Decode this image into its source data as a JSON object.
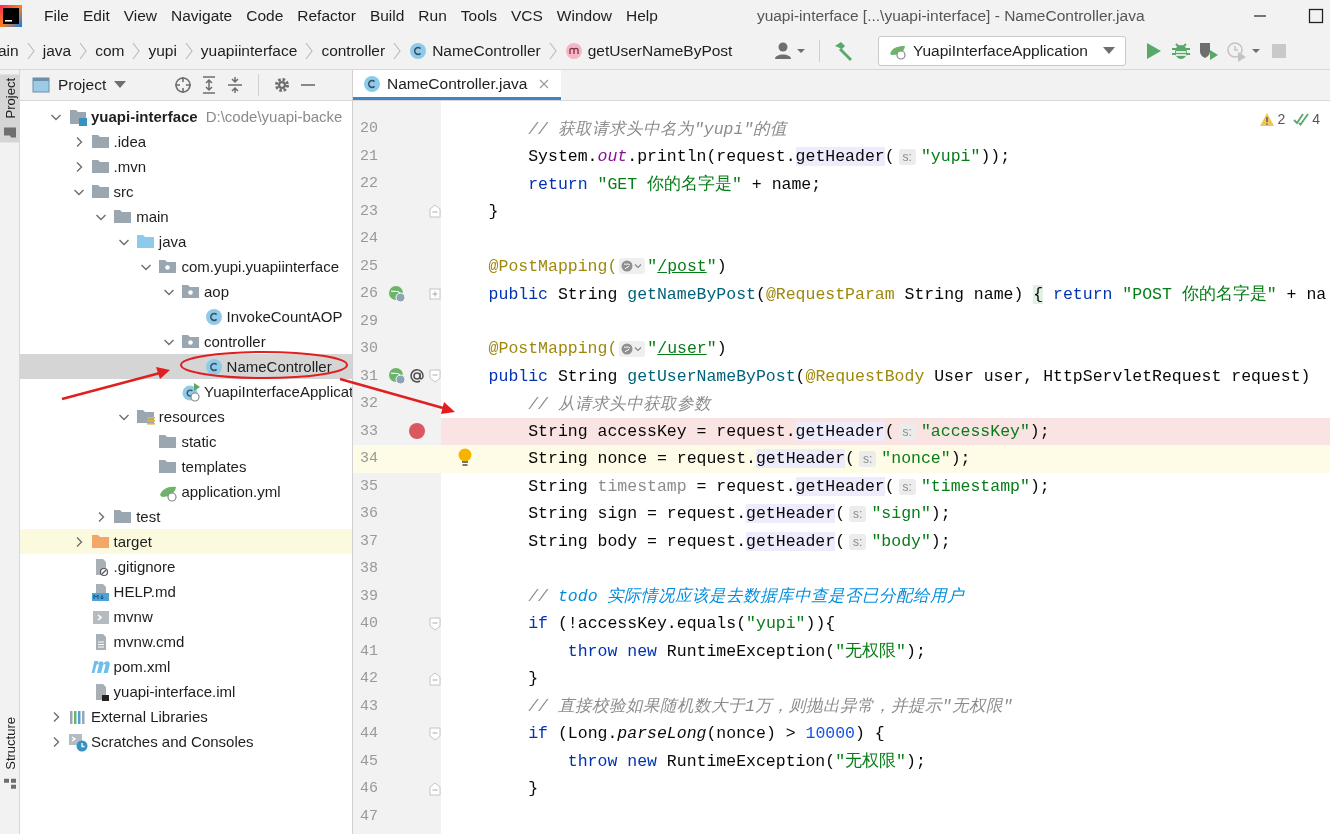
{
  "window": {
    "title": "yuapi-interface [...\\yuapi-interface] - NameController.java"
  },
  "menu": [
    "File",
    "Edit",
    "View",
    "Navigate",
    "Code",
    "Refactor",
    "Build",
    "Run",
    "Tools",
    "VCS",
    "Window",
    "Help"
  ],
  "breadcrumbs": [
    {
      "label": "ain",
      "kind": "plain"
    },
    {
      "label": "java",
      "kind": "plain"
    },
    {
      "label": "com",
      "kind": "plain"
    },
    {
      "label": "yupi",
      "kind": "plain"
    },
    {
      "label": "yuapiinterface",
      "kind": "plain"
    },
    {
      "label": "controller",
      "kind": "plain"
    },
    {
      "label": "NameController",
      "kind": "class"
    },
    {
      "label": "getUserNameByPost",
      "kind": "method"
    }
  ],
  "run_config": {
    "label": "YuapiInterfaceApplication"
  },
  "side_strip": [
    {
      "label": "Project",
      "selected": true
    },
    {
      "label": "Structure",
      "selected": false
    }
  ],
  "project_panel": {
    "title": "Project",
    "tree": [
      {
        "label": "yuapi-interface",
        "path": "D:\\code\\yuapi-backe",
        "kind": "module",
        "expanded": true,
        "selected": false,
        "children": [
          {
            "label": ".idea",
            "kind": "folder",
            "expanded": false,
            "selected": false
          },
          {
            "label": ".mvn",
            "kind": "folder",
            "expanded": false,
            "selected": false
          },
          {
            "label": "src",
            "kind": "folder",
            "expanded": true,
            "selected": false,
            "children": [
              {
                "label": "main",
                "kind": "folder",
                "expanded": true,
                "selected": false,
                "children": [
                  {
                    "label": "java",
                    "kind": "source",
                    "expanded": true,
                    "selected": false,
                    "children": [
                      {
                        "label": "com.yupi.yuapiinterface",
                        "kind": "package",
                        "expanded": true,
                        "selected": false,
                        "children": [
                          {
                            "label": "aop",
                            "kind": "package",
                            "expanded": true,
                            "selected": false,
                            "children": [
                              {
                                "label": "InvokeCountAOP",
                                "kind": "class",
                                "selected": false
                              }
                            ]
                          },
                          {
                            "label": "controller",
                            "kind": "package",
                            "expanded": true,
                            "selected": false,
                            "children": [
                              {
                                "label": "NameController",
                                "kind": "class",
                                "selected": true
                              }
                            ]
                          },
                          {
                            "label": "YuapiInterfaceApplicat",
                            "kind": "spring-class",
                            "selected": false
                          }
                        ]
                      }
                    ]
                  },
                  {
                    "label": "resources",
                    "kind": "resources",
                    "expanded": true,
                    "selected": false,
                    "children": [
                      {
                        "label": "static",
                        "kind": "folder",
                        "selected": false
                      },
                      {
                        "label": "templates",
                        "kind": "folder",
                        "selected": false
                      },
                      {
                        "label": "application.yml",
                        "kind": "yaml",
                        "selected": false
                      }
                    ]
                  }
                ]
              },
              {
                "label": "test",
                "kind": "folder",
                "expanded": false,
                "selected": false
              }
            ]
          },
          {
            "label": "target",
            "kind": "excluded",
            "expanded": false,
            "selected": false
          },
          {
            "label": ".gitignore",
            "kind": "ignore",
            "selected": false
          },
          {
            "label": "HELP.md",
            "kind": "markdown",
            "selected": false
          },
          {
            "label": "mvnw",
            "kind": "script",
            "selected": false
          },
          {
            "label": "mvnw.cmd",
            "kind": "text",
            "selected": false
          },
          {
            "label": "pom.xml",
            "kind": "maven",
            "selected": false
          },
          {
            "label": "yuapi-interface.iml",
            "kind": "iml",
            "selected": false
          }
        ]
      },
      {
        "label": "External Libraries",
        "kind": "libraries",
        "expanded": false,
        "selected": false
      },
      {
        "label": "Scratches and Consoles",
        "kind": "scratches",
        "expanded": false,
        "selected": false
      }
    ]
  },
  "editor": {
    "tabs": [
      {
        "label": "NameController.java",
        "selected": true
      }
    ],
    "inspections": {
      "warnings": "2",
      "passed": "4"
    },
    "lines": [
      {
        "num": "20",
        "kind": "plain",
        "tokens": [
          {
            "text": "        // 获取请求头中名为\"yupi\"的值",
            "kind": "comment"
          }
        ]
      },
      {
        "num": "21",
        "kind": "plain",
        "tokens": [
          {
            "text": "        System.",
            "kind": "plain"
          },
          {
            "text": "out",
            "kind": "field"
          },
          {
            "text": ".println(request.",
            "kind": "plain"
          },
          {
            "text": "getHeader",
            "kind": "hl"
          },
          {
            "text": "(",
            "kind": "plain"
          },
          {
            "text": "s:",
            "kind": "hint"
          },
          {
            "text": "\"yupi\"",
            "kind": "str"
          },
          {
            "text": "));",
            "kind": "plain"
          }
        ]
      },
      {
        "num": "22",
        "kind": "plain",
        "tokens": [
          {
            "text": "        return",
            "kind": "kw"
          },
          {
            "text": " \"GET 你的名字是\"",
            "kind": "str"
          },
          {
            "text": " + name;",
            "kind": "plain"
          }
        ]
      },
      {
        "num": "23",
        "kind": "plain",
        "markers": [
          {
            "kind": "fold-close"
          }
        ],
        "tokens": [
          {
            "text": "    }",
            "kind": "plain"
          }
        ]
      },
      {
        "num": "24",
        "kind": "plain"
      },
      {
        "num": "25",
        "kind": "plain",
        "tokens": [
          {
            "text": "    @PostMapping(",
            "kind": "anno"
          },
          {
            "kind": "url-icon"
          },
          {
            "text": "\"",
            "kind": "str"
          },
          {
            "text": "/post",
            "kind": "url"
          },
          {
            "text": "\"",
            "kind": "str"
          },
          {
            "text": ")",
            "kind": "plain"
          }
        ]
      },
      {
        "num": "26",
        "kind": "plain",
        "markers": [
          {
            "kind": "web-bean"
          },
          {
            "kind": "fold-collapsed"
          }
        ],
        "tokens": [
          {
            "text": "    public",
            "kind": "kw"
          },
          {
            "text": " String ",
            "kind": "plain"
          },
          {
            "text": "getNameByPost",
            "kind": "method"
          },
          {
            "text": "(",
            "kind": "plain"
          },
          {
            "text": "@RequestParam",
            "kind": "anno"
          },
          {
            "text": " String name) ",
            "kind": "plain"
          },
          {
            "text": "{",
            "kind": "brace"
          },
          {
            "text": " return",
            "kind": "kw"
          },
          {
            "text": " \"POST 你的名字是\"",
            "kind": "str"
          },
          {
            "text": " + na",
            "kind": "plain"
          }
        ]
      },
      {
        "num": "29",
        "kind": "plain"
      },
      {
        "num": "30",
        "kind": "plain",
        "tokens": [
          {
            "text": "    @PostMapping(",
            "kind": "anno"
          },
          {
            "kind": "url-icon"
          },
          {
            "text": "\"",
            "kind": "str"
          },
          {
            "text": "/user",
            "kind": "url"
          },
          {
            "text": "\"",
            "kind": "str"
          },
          {
            "text": ")",
            "kind": "plain"
          }
        ]
      },
      {
        "num": "31",
        "kind": "plain",
        "markers": [
          {
            "kind": "web-bean"
          },
          {
            "kind": "at"
          },
          {
            "kind": "fold-open"
          }
        ],
        "tokens": [
          {
            "text": "    public",
            "kind": "kw"
          },
          {
            "text": " String ",
            "kind": "plain"
          },
          {
            "text": "getUserNameByPost",
            "kind": "method"
          },
          {
            "text": "(",
            "kind": "plain"
          },
          {
            "text": "@RequestBody",
            "kind": "anno"
          },
          {
            "text": " User user, HttpServletRequest request)",
            "kind": "plain"
          }
        ]
      },
      {
        "num": "32",
        "kind": "plain",
        "tokens": [
          {
            "text": "        // 从请求头中获取参数",
            "kind": "comment"
          }
        ]
      },
      {
        "num": "33",
        "kind": "breakpoint",
        "markers": [
          {
            "kind": "breakpoint"
          }
        ],
        "tokens": [
          {
            "text": "        String accessKey = request.",
            "kind": "plain"
          },
          {
            "text": "getHeader",
            "kind": "hl"
          },
          {
            "text": "(",
            "kind": "plain"
          },
          {
            "text": "s:",
            "kind": "hint"
          },
          {
            "text": "\"accessKey\"",
            "kind": "str"
          },
          {
            "text": ");",
            "kind": "plain"
          }
        ]
      },
      {
        "num": "34",
        "kind": "caret",
        "bulb": true,
        "tokens": [
          {
            "text": "        String nonce = request.",
            "kind": "plain"
          },
          {
            "text": "getHeader",
            "kind": "hl"
          },
          {
            "text": "(",
            "kind": "plain"
          },
          {
            "text": "s:",
            "kind": "hint"
          },
          {
            "text": "\"nonce\"",
            "kind": "str"
          },
          {
            "text": ");",
            "kind": "plain"
          }
        ]
      },
      {
        "num": "35",
        "kind": "plain",
        "tokens": [
          {
            "text": "        String ",
            "kind": "plain"
          },
          {
            "text": "timestamp",
            "kind": "unused"
          },
          {
            "text": " = request.",
            "kind": "plain"
          },
          {
            "text": "getHeader",
            "kind": "hl"
          },
          {
            "text": "(",
            "kind": "plain"
          },
          {
            "text": "s:",
            "kind": "hint"
          },
          {
            "text": "\"timestamp\"",
            "kind": "str"
          },
          {
            "text": ");",
            "kind": "plain"
          }
        ]
      },
      {
        "num": "36",
        "kind": "plain",
        "tokens": [
          {
            "text": "        String sign = request.",
            "kind": "plain"
          },
          {
            "text": "getHeader",
            "kind": "hl"
          },
          {
            "text": "(",
            "kind": "plain"
          },
          {
            "text": "s:",
            "kind": "hint"
          },
          {
            "text": "\"sign\"",
            "kind": "str"
          },
          {
            "text": ");",
            "kind": "plain"
          }
        ]
      },
      {
        "num": "37",
        "kind": "plain",
        "tokens": [
          {
            "text": "        String body = request.",
            "kind": "plain"
          },
          {
            "text": "getHeader",
            "kind": "hl"
          },
          {
            "text": "(",
            "kind": "plain"
          },
          {
            "text": "s:",
            "kind": "hint"
          },
          {
            "text": "\"body\"",
            "kind": "str"
          },
          {
            "text": ");",
            "kind": "plain"
          }
        ]
      },
      {
        "num": "38",
        "kind": "plain"
      },
      {
        "num": "39",
        "kind": "plain",
        "tokens": [
          {
            "text": "        // ",
            "kind": "comment"
          },
          {
            "text": "todo 实际情况应该是去数据库中查是否已分配给用户",
            "kind": "todo"
          }
        ]
      },
      {
        "num": "40",
        "kind": "plain",
        "markers": [
          {
            "kind": "fold-open"
          }
        ],
        "tokens": [
          {
            "text": "        if",
            "kind": "kw"
          },
          {
            "text": " (!accessKey.equals(",
            "kind": "plain"
          },
          {
            "text": "\"yupi\"",
            "kind": "str"
          },
          {
            "text": ")){",
            "kind": "plain"
          }
        ]
      },
      {
        "num": "41",
        "kind": "plain",
        "tokens": [
          {
            "text": "            throw",
            "kind": "kw"
          },
          {
            "text": " new",
            "kind": "kw"
          },
          {
            "text": " RuntimeException(",
            "kind": "plain"
          },
          {
            "text": "\"无权限\"",
            "kind": "str"
          },
          {
            "text": ");",
            "kind": "plain"
          }
        ]
      },
      {
        "num": "42",
        "kind": "plain",
        "markers": [
          {
            "kind": "fold-close"
          }
        ],
        "tokens": [
          {
            "text": "        }",
            "kind": "plain"
          }
        ]
      },
      {
        "num": "43",
        "kind": "plain",
        "tokens": [
          {
            "text": "        // 直接校验如果随机数大于1万，则抛出异常，并提示\"无权限\"",
            "kind": "comment"
          }
        ]
      },
      {
        "num": "44",
        "kind": "plain",
        "markers": [
          {
            "kind": "fold-open"
          }
        ],
        "tokens": [
          {
            "text": "        if",
            "kind": "kw"
          },
          {
            "text": " (Long.",
            "kind": "plain"
          },
          {
            "text": "parseLong",
            "kind": "static"
          },
          {
            "text": "(nonce) > ",
            "kind": "plain"
          },
          {
            "text": "10000",
            "kind": "num"
          },
          {
            "text": ") {",
            "kind": "plain"
          }
        ]
      },
      {
        "num": "45",
        "kind": "plain",
        "tokens": [
          {
            "text": "            throw",
            "kind": "kw"
          },
          {
            "text": " new",
            "kind": "kw"
          },
          {
            "text": " RuntimeException(",
            "kind": "plain"
          },
          {
            "text": "\"无权限\"",
            "kind": "str"
          },
          {
            "text": ");",
            "kind": "plain"
          }
        ]
      },
      {
        "num": "46",
        "kind": "plain",
        "markers": [
          {
            "kind": "fold-close"
          }
        ],
        "tokens": [
          {
            "text": "        }",
            "kind": "plain"
          }
        ]
      },
      {
        "num": "47",
        "kind": "plain"
      }
    ]
  }
}
